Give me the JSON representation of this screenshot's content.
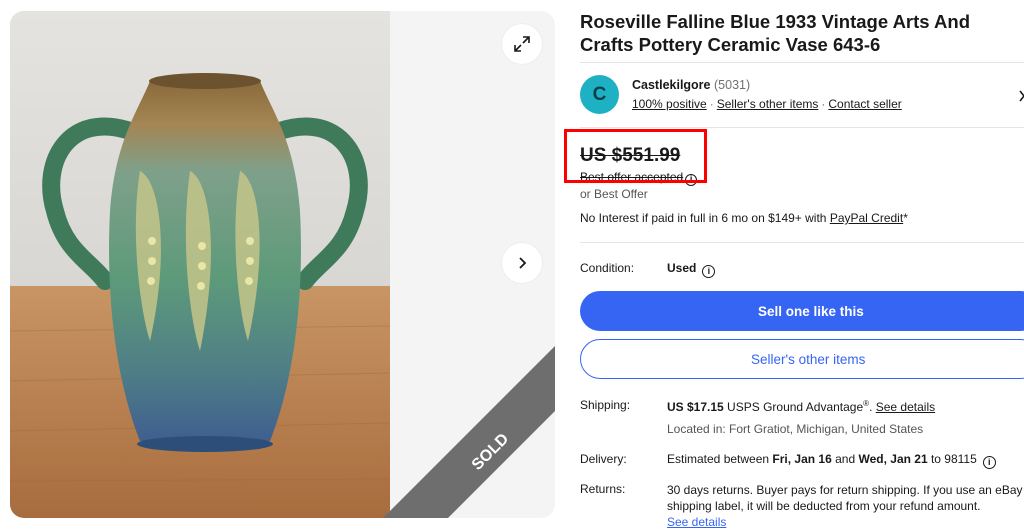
{
  "listing": {
    "title": "Roseville Falline Blue 1933 Vintage Arts And Crafts Pottery Ceramic Vase 643-6",
    "sold_label": "SOLD",
    "photo_alt": "Blue green ceramic vase with two handles on a wooden table"
  },
  "seller": {
    "avatar_letter": "C",
    "name": "Castlekilgore",
    "feedback_count": "(5031)",
    "positive": "100% positive",
    "other_items": "Seller's other items",
    "contact": "Contact seller",
    "separator": "·"
  },
  "price": {
    "amount": "US $551.99",
    "best_offer_accepted": "Best offer accepted",
    "or_best_offer": "or Best Offer",
    "no_interest_prefix": "No Interest if paid in full in 6 mo on $149+ with ",
    "paypal_credit": "PayPal Credit",
    "asterisk": "*"
  },
  "condition": {
    "label": "Condition:",
    "value": "Used"
  },
  "buttons": {
    "sell_one": "Sell one like this",
    "sellers_other_items": "Seller's other items"
  },
  "shipping": {
    "label": "Shipping:",
    "cost": "US $17.15",
    "service": " USPS Ground Advantage",
    "registered": "®",
    "dot": ". ",
    "see_details": "See details",
    "located": "Located in: Fort Gratiot, Michigan, United States"
  },
  "delivery": {
    "label": "Delivery:",
    "prefix": "Estimated between ",
    "start": "Fri, Jan 16",
    "and": " and ",
    "end": "Wed, Jan 21",
    "suffix": " to 98115"
  },
  "returns": {
    "label": "Returns:",
    "line1": "30 days returns. Buyer pays for return shipping. If you use an eBay",
    "line2": "shipping label, it will be deducted from your refund amount.",
    "see_details": "See details"
  },
  "colors": {
    "accent": "#3665f3",
    "highlight_box": "#ff0000",
    "avatar": "#1eb1c4",
    "sold_ribbon": "#6e6e6e"
  },
  "icons": {
    "expand": "expand-icon",
    "next": "chevron-right-icon",
    "info": "info-icon"
  }
}
